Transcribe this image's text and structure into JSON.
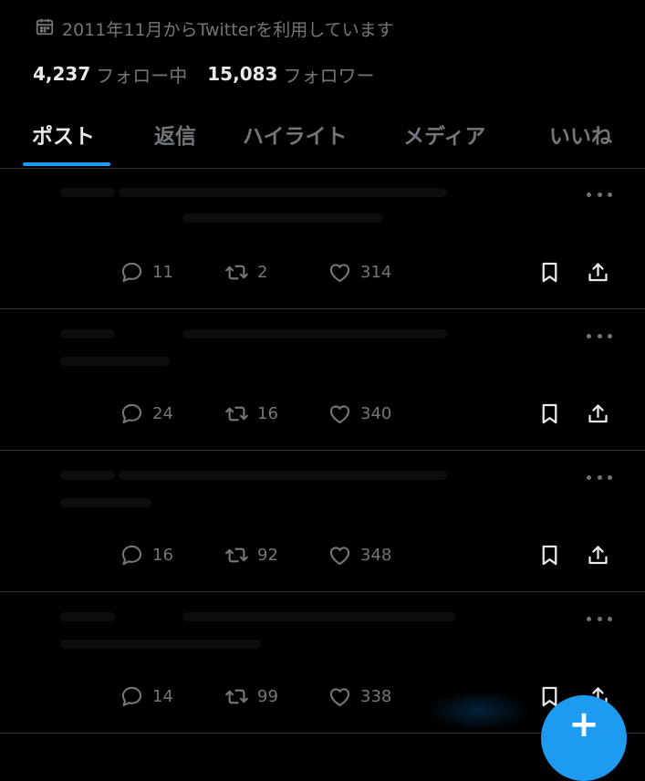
{
  "profile": {
    "joined": "2011年11月からTwitterを利用しています",
    "following_count": "4,237",
    "following_label": "フォロー中",
    "followers_count": "15,083",
    "followers_label": "フォロワー"
  },
  "tabs": [
    {
      "label": "ポスト",
      "active": true
    },
    {
      "label": "返信",
      "active": false
    },
    {
      "label": "ハイライト",
      "active": false
    },
    {
      "label": "メディア",
      "active": false
    },
    {
      "label": "いいね",
      "active": false
    }
  ],
  "posts": [
    {
      "replies": "11",
      "reposts": "2",
      "likes": "314"
    },
    {
      "replies": "24",
      "reposts": "16",
      "likes": "340"
    },
    {
      "replies": "16",
      "reposts": "92",
      "likes": "348"
    },
    {
      "replies": "14",
      "reposts": "99",
      "likes": "338"
    }
  ],
  "icons": {
    "calendar": "calendar-icon",
    "reply": "reply-icon",
    "repost": "repost-icon",
    "like": "heart-icon",
    "bookmark": "bookmark-icon",
    "share": "share-icon",
    "more": "more-icon",
    "compose": "compose-plus-icon"
  },
  "colors": {
    "background": "#000000",
    "text": "#e7e9ea",
    "muted": "#71767b",
    "accent": "#1d9bf0",
    "divider": "#2f3336"
  },
  "fab": {
    "label": "+"
  }
}
